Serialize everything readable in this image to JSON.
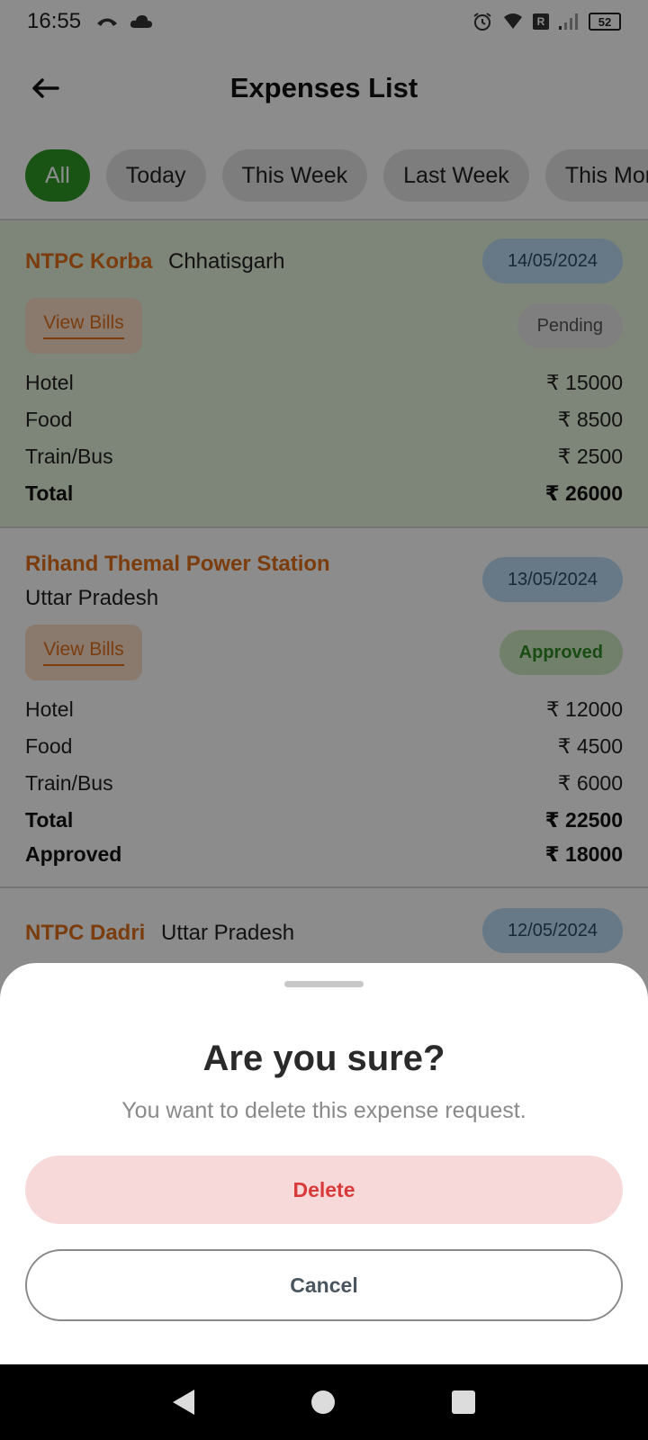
{
  "status_bar": {
    "time": "16:55",
    "battery": "52",
    "network_badge": "R"
  },
  "header": {
    "title": "Expenses List"
  },
  "filters": [
    {
      "label": "All",
      "active": true
    },
    {
      "label": "Today",
      "active": false
    },
    {
      "label": "This Week",
      "active": false
    },
    {
      "label": "Last Week",
      "active": false
    },
    {
      "label": "This Month",
      "active": false
    }
  ],
  "currency": "₹",
  "expenses": [
    {
      "site": "NTPC Korba",
      "state": "Chhatisgarh",
      "date": "14/05/2024",
      "view_bills_label": "View Bills",
      "status": "Pending",
      "items": [
        {
          "label": "Hotel",
          "amount": "₹ 15000"
        },
        {
          "label": "Food",
          "amount": "₹ 8500"
        },
        {
          "label": "Train/Bus",
          "amount": "₹ 2500"
        }
      ],
      "total_label": "Total",
      "total": "₹ 26000"
    },
    {
      "site": "Rihand Themal Power Station",
      "state": "Uttar Pradesh",
      "date": "13/05/2024",
      "view_bills_label": "View Bills",
      "status": "Approved",
      "items": [
        {
          "label": "Hotel",
          "amount": "₹ 12000"
        },
        {
          "label": "Food",
          "amount": "₹ 4500"
        },
        {
          "label": "Train/Bus",
          "amount": "₹ 6000"
        }
      ],
      "total_label": "Total",
      "total": "₹ 22500",
      "approved_label": "Approved",
      "approved": "₹ 18000"
    },
    {
      "site": "NTPC Dadri",
      "state": "Uttar Pradesh",
      "date": "12/05/2024"
    }
  ],
  "dialog": {
    "title": "Are you sure?",
    "message": "You want to delete this expense request.",
    "delete_label": "Delete",
    "cancel_label": "Cancel"
  },
  "colors": {
    "accent_green": "#2f9a26",
    "site_orange": "#e0701a",
    "delete_red": "#d83a3a"
  }
}
